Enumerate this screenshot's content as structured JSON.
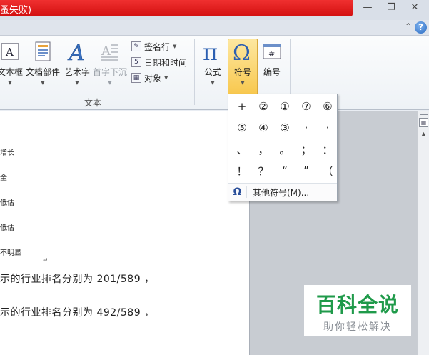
{
  "titlebar": {
    "title_fragment": "蚤失败)",
    "minimize_icon": "minimize-icon",
    "restore_icon": "restore-icon",
    "close_icon": "close-icon"
  },
  "ribbon_top": {
    "help_label": "?"
  },
  "ribbon": {
    "text_group": {
      "label": "文本",
      "buttons": [
        "文本框",
        "文档部件",
        "艺术字",
        "首字下沉"
      ],
      "small_buttons": [
        "签名行",
        "日期和时间",
        "对象"
      ]
    },
    "symbols_group": {
      "buttons": [
        "公式",
        "符号",
        "编号"
      ]
    }
  },
  "document": {
    "short_lines": [
      "增长",
      "全",
      "低估",
      "低估",
      "不明显"
    ],
    "long_lines": [
      "示的行业排名分别为 201/589 ，",
      "示的行业排名分别为 492/589 ，"
    ]
  },
  "symbol_dropdown": {
    "symbols": [
      "+",
      "②",
      "①",
      "⑦",
      "⑥",
      "⑤",
      "④",
      "③",
      "·",
      "·",
      "、",
      "，",
      "。",
      "；",
      "：",
      "！",
      "？",
      "“",
      "”",
      "（"
    ],
    "more_label": "其他符号(M)..."
  },
  "watermark": {
    "title": "百科全说",
    "subtitle": "助你轻松解决"
  }
}
